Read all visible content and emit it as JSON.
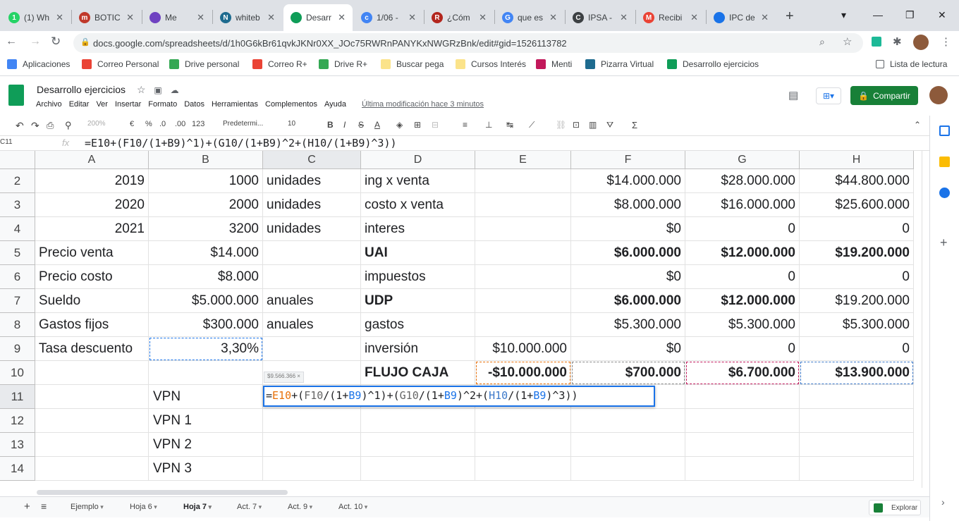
{
  "browser": {
    "tabs": [
      {
        "title": "(1) Wh",
        "icon_color": "#25d366",
        "icon_glyph": "1"
      },
      {
        "title": "BOTIC",
        "icon_color": "#c0392b",
        "icon_glyph": "m"
      },
      {
        "title": "Me",
        "icon_color": "#6f42c1",
        "icon_glyph": ""
      },
      {
        "title": "whiteb",
        "icon_color": "#1e6b8f",
        "icon_glyph": "N"
      },
      {
        "title": "Desarr",
        "icon_color": "#0f9d58",
        "icon_glyph": "",
        "active": true
      },
      {
        "title": "1/06 -",
        "icon_color": "#4285f4",
        "icon_glyph": "c"
      },
      {
        "title": "¿Cóm",
        "icon_color": "#b3261e",
        "icon_glyph": "R"
      },
      {
        "title": "que es",
        "icon_color": "#4285f4",
        "icon_glyph": "G"
      },
      {
        "title": "IPSA -",
        "icon_color": "#3c4043",
        "icon_glyph": "C"
      },
      {
        "title": "Recibi",
        "icon_color": "#ea4335",
        "icon_glyph": "M"
      },
      {
        "title": "IPC de",
        "icon_color": "#1a73e8",
        "icon_glyph": ""
      }
    ],
    "url": "docs.google.com/spreadsheets/d/1h0G6kBr61qvkJKNr0XX_JOc75RWRnPANYKxNWGRzBnk/edit#gid=1526113782",
    "bookmarks": [
      "Aplicaciones",
      "Correo Personal",
      "Drive personal",
      "Correo R+",
      "Drive R+",
      "Buscar pega",
      "Cursos Interés",
      "Menti",
      "Pizarra Virtual",
      "Desarrollo ejercicios"
    ],
    "reading_list": "Lista de lectura"
  },
  "doc": {
    "title": "Desarrollo ejercicios",
    "menus": [
      "Archivo",
      "Editar",
      "Ver",
      "Insertar",
      "Formato",
      "Datos",
      "Herramientas",
      "Complementos",
      "Ayuda"
    ],
    "last_modified": "Última modificación hace 3 minutos",
    "share": "Compartir"
  },
  "format_toolbar": {
    "zoom": "200%",
    "currency": "€",
    "percent": "%",
    "dec_less": ".0",
    "dec_more": ".00",
    "format_123": "123",
    "font": "Predetermi...",
    "font_size": "10"
  },
  "formula_bar": {
    "name_box": "C11",
    "fx": "fx",
    "formula": "=E10+(F10/(1+B9)^1)+(G10/(1+B9)^2+(H10/(1+B9)^3))"
  },
  "columns": [
    "A",
    "B",
    "C",
    "D",
    "E",
    "F",
    "G",
    "H"
  ],
  "rows": [
    {
      "n": "2",
      "cells": [
        "2019",
        "1000",
        "unidades",
        "ing x venta",
        "",
        "$14.000.000",
        "$28.000.000",
        "$44.800.000"
      ]
    },
    {
      "n": "3",
      "cells": [
        "2020",
        "2000",
        "unidades",
        "costo x venta",
        "",
        "$8.000.000",
        "$16.000.000",
        "$25.600.000"
      ]
    },
    {
      "n": "4",
      "cells": [
        "2021",
        "3200",
        "unidades",
        "interes",
        "",
        "$0",
        "0",
        "0"
      ]
    },
    {
      "n": "5",
      "cells": [
        "Precio venta",
        "$14.000",
        "",
        "UAI",
        "",
        "$6.000.000",
        "$12.000.000",
        "$19.200.000"
      ]
    },
    {
      "n": "6",
      "cells": [
        "Precio costo",
        "$8.000",
        "",
        "impuestos",
        "",
        "$0",
        "0",
        "0"
      ]
    },
    {
      "n": "7",
      "cells": [
        "Sueldo",
        "$5.000.000",
        "anuales",
        "UDP",
        "",
        "$6.000.000",
        "$12.000.000",
        "$19.200.000"
      ]
    },
    {
      "n": "8",
      "cells": [
        "Gastos fijos",
        "$300.000",
        "anuales",
        "gastos",
        "",
        "$5.300.000",
        "$5.300.000",
        "$5.300.000"
      ]
    },
    {
      "n": "9",
      "cells": [
        "Tasa descuento",
        "3,30%",
        "",
        "inversión",
        "$10.000.000",
        "$0",
        "0",
        "0"
      ]
    },
    {
      "n": "10",
      "cells": [
        "",
        "",
        "",
        "FLUJO CAJA",
        "-$10.000.000",
        "$700.000",
        "$6.700.000",
        "$13.900.000"
      ]
    },
    {
      "n": "11",
      "cells": [
        "",
        "VPN",
        "",
        "",
        "",
        "",
        "",
        ""
      ]
    },
    {
      "n": "12",
      "cells": [
        "",
        "VPN 1",
        "",
        "",
        "",
        "",
        "",
        ""
      ]
    },
    {
      "n": "13",
      "cells": [
        "",
        "VPN 2",
        "",
        "",
        "",
        "",
        "",
        ""
      ]
    },
    {
      "n": "14",
      "cells": [
        "",
        "VPN 3",
        "",
        "",
        "",
        "",
        "",
        ""
      ]
    }
  ],
  "editor": {
    "hint": "$9.566.366 ×",
    "parts": [
      {
        "t": "=",
        "c": "#202124"
      },
      {
        "t": "E10",
        "c": "#e8710a"
      },
      {
        "t": "+(",
        "c": "#202124"
      },
      {
        "t": "F10",
        "c": "#666"
      },
      {
        "t": "/(1+",
        "c": "#202124"
      },
      {
        "t": "B9",
        "c": "#1a73e8"
      },
      {
        "t": ")^1)+(",
        "c": "#202124"
      },
      {
        "t": "G10",
        "c": "#666"
      },
      {
        "t": "/(1+",
        "c": "#202124"
      },
      {
        "t": "B9",
        "c": "#1a73e8"
      },
      {
        "t": ")^2+(",
        "c": "#202124"
      },
      {
        "t": "H10",
        "c": "#3b78c9"
      },
      {
        "t": "/(1+",
        "c": "#202124"
      },
      {
        "t": "B9",
        "c": "#1a73e8"
      },
      {
        "t": ")^3))",
        "c": "#202124"
      }
    ]
  },
  "sheet_tabs": [
    "Ejemplo",
    "Hoja 6",
    "Hoja 7",
    "Act. 7",
    "Act. 9",
    "Act. 10"
  ],
  "active_sheet": "Hoja 7",
  "explore": "Explorar"
}
